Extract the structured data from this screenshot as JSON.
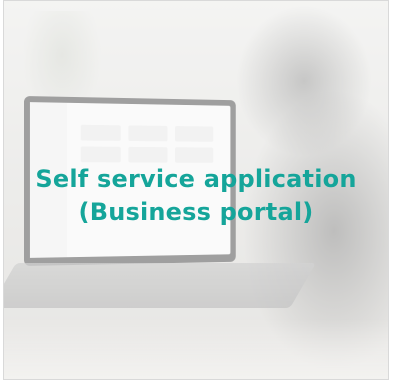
{
  "card": {
    "title_line1": "Self service application",
    "title_line2": "(Business portal)"
  },
  "colors": {
    "title": "#15a59a",
    "border": "#d9d9d9",
    "overlay": "rgba(255,255,255,0.55)"
  }
}
